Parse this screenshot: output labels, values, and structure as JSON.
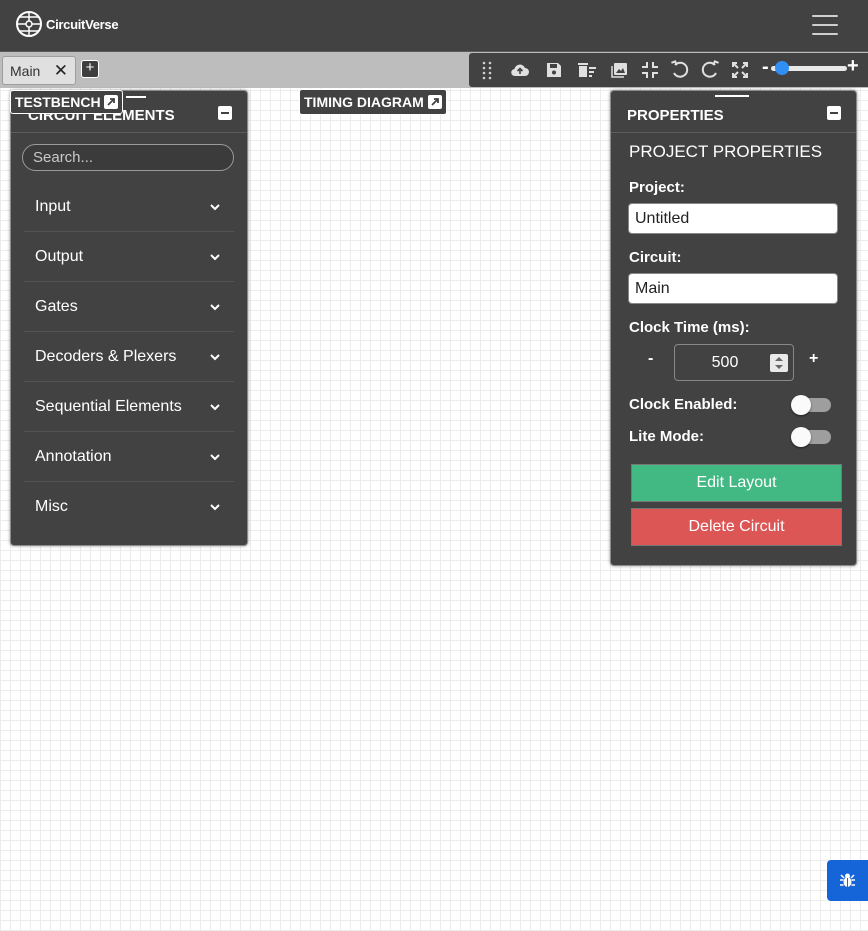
{
  "navbar": {
    "logo_text": "CircuitVerse",
    "menu_icon": "hamburger-menu-icon"
  },
  "tabs": [
    {
      "label": "Main",
      "close_icon": "close-icon"
    }
  ],
  "add_tab_icon": "plus-icon",
  "toolbar": {
    "icons": [
      "drag-handle-icon",
      "cloud-upload-icon",
      "save-icon",
      "delete-all-icon",
      "image-icon",
      "fit-screen-icon",
      "undo-icon",
      "redo-icon",
      "fullscreen-icon"
    ],
    "zoom_minus": "-",
    "zoom_plus": "+",
    "zoom_level": 0.06
  },
  "circuit_elements": {
    "title": "CIRCUIT ELEMENTS",
    "search_placeholder": "Search...",
    "categories": [
      {
        "label": "Input"
      },
      {
        "label": "Output"
      },
      {
        "label": "Gates"
      },
      {
        "label": "Decoders & Plexers"
      },
      {
        "label": "Sequential Elements"
      },
      {
        "label": "Annotation"
      },
      {
        "label": "Misc"
      }
    ]
  },
  "testbench": {
    "label": "TESTBENCH"
  },
  "timing_diagram": {
    "label": "TIMING DIAGRAM"
  },
  "properties": {
    "title": "PROPERTIES",
    "subtitle": "PROJECT PROPERTIES",
    "project_label": "Project:",
    "project_value": "Untitled",
    "circuit_label": "Circuit:",
    "circuit_value": "Main",
    "clock_time_label": "Clock Time (ms):",
    "clock_minus": "-",
    "clock_value": "500",
    "clock_plus": "+",
    "clock_enabled_label": "Clock Enabled:",
    "clock_enabled": false,
    "lite_mode_label": "Lite Mode:",
    "lite_mode": false,
    "edit_layout_label": "Edit Layout",
    "delete_circuit_label": "Delete Circuit"
  },
  "colors": {
    "panel_bg": "#424242",
    "edit_button": "#42b983",
    "delete_button": "#dc5656",
    "bug_button": "#1565d8",
    "zoom_thumb": "#2f8ff5"
  },
  "bug_report_icon": "bug-icon"
}
